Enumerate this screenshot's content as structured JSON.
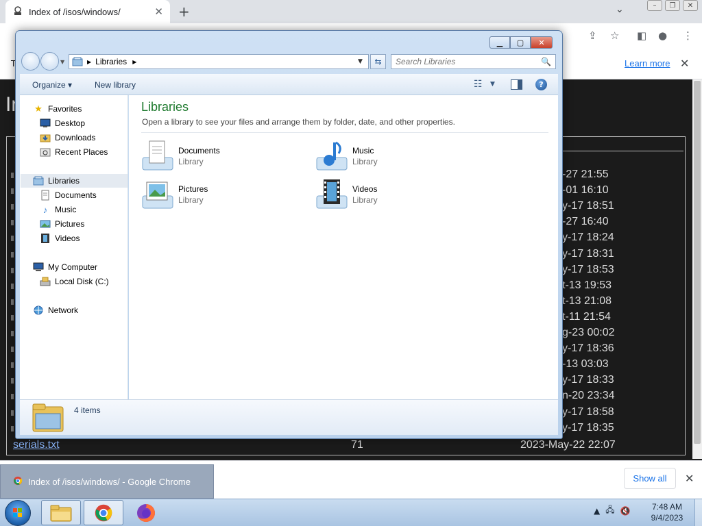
{
  "browser": {
    "tab_title": "Index of /isos/windows/",
    "new_tab_label": "+",
    "infobar_letter": "T",
    "infobar_learn_more": "Learn more",
    "page_heading_fragment": "In",
    "listing_dates": [
      "-27 21:55",
      "-01 16:10",
      "y-17 18:51",
      "-27 16:40",
      "y-17 18:24",
      "y-17 18:31",
      "y-17 18:53",
      "t-13 19:53",
      "t-13 21:08",
      "t-11 21:54",
      "g-23 00:02",
      "y-17 18:36",
      "-13 03:03",
      "y-17 18:33",
      "n-20 23:34",
      "y-17 18:58",
      "y-17 18:35"
    ],
    "last_row": {
      "name": "serials.txt",
      "size": "71",
      "date": "2023-May-22 22:07"
    },
    "downloads": {
      "item_label": "Index of /isos/windows/ - Google Chrome",
      "show_all": "Show all"
    }
  },
  "explorer": {
    "breadcrumb": "Libraries",
    "search_placeholder": "Search Libraries",
    "commands": {
      "organize": "Organize",
      "new_library": "New library"
    },
    "nav": {
      "favorites": "Favorites",
      "desktop": "Desktop",
      "downloads": "Downloads",
      "recent_places": "Recent Places",
      "libraries": "Libraries",
      "documents": "Documents",
      "music": "Music",
      "pictures": "Pictures",
      "videos": "Videos",
      "my_computer": "My Computer",
      "local_disk": "Local Disk (C:)",
      "network": "Network"
    },
    "content": {
      "title": "Libraries",
      "subtitle": "Open a library to see your files and arrange them by folder, date, and other properties.",
      "libraries": [
        {
          "name": "Documents",
          "type": "Library"
        },
        {
          "name": "Music",
          "type": "Library"
        },
        {
          "name": "Pictures",
          "type": "Library"
        },
        {
          "name": "Videos",
          "type": "Library"
        }
      ]
    },
    "details": {
      "count": "4 items"
    }
  },
  "taskbar": {
    "clock_time": "7:48 AM",
    "clock_date": "9/4/2023"
  },
  "colors": {
    "library_title": "#1e7a2e",
    "link": "#1a73e8"
  }
}
